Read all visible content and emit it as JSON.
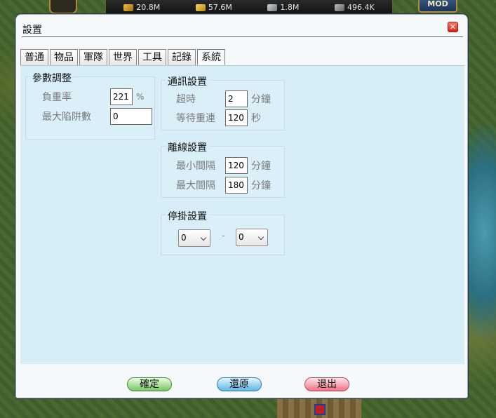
{
  "game_hud": {
    "resources": [
      {
        "icon": "gold-icon",
        "value": "20.8M"
      },
      {
        "icon": "wheat-icon",
        "value": "57.6M"
      },
      {
        "icon": "iron-icon",
        "value": "1.8M"
      },
      {
        "icon": "wood-icon",
        "value": "496.4K"
      }
    ],
    "mod_label": "MOD"
  },
  "dialog": {
    "title": "設置",
    "close_icon": "close-icon",
    "tabs": [
      {
        "label": "普通"
      },
      {
        "label": "物品"
      },
      {
        "label": "軍隊"
      },
      {
        "label": "世界"
      },
      {
        "label": "工具"
      },
      {
        "label": "記錄"
      },
      {
        "label": "系統",
        "active": true
      }
    ],
    "params": {
      "legend": "參數調整",
      "load_rate_label": "負重率",
      "load_rate_value": "221",
      "load_rate_unit": "%",
      "max_traps_label": "最大陷阱數",
      "max_traps_value": "0"
    },
    "comm": {
      "legend": "通訊設置",
      "timeout_label": "超時",
      "timeout_value": "2",
      "timeout_unit": "分鐘",
      "reconnect_label": "等待重連",
      "reconnect_value": "120",
      "reconnect_unit": "秒"
    },
    "offline": {
      "legend": "離線設置",
      "min_interval_label": "最小間隔",
      "min_interval_value": "120",
      "min_interval_unit": "分鐘",
      "max_interval_label": "最大間隔",
      "max_interval_value": "180",
      "max_interval_unit": "分鐘"
    },
    "pause": {
      "legend": "停掛設置",
      "start_value": "0",
      "separator": "-",
      "end_value": "0"
    },
    "buttons": {
      "confirm": "確定",
      "restore": "還原",
      "exit": "退出"
    }
  }
}
